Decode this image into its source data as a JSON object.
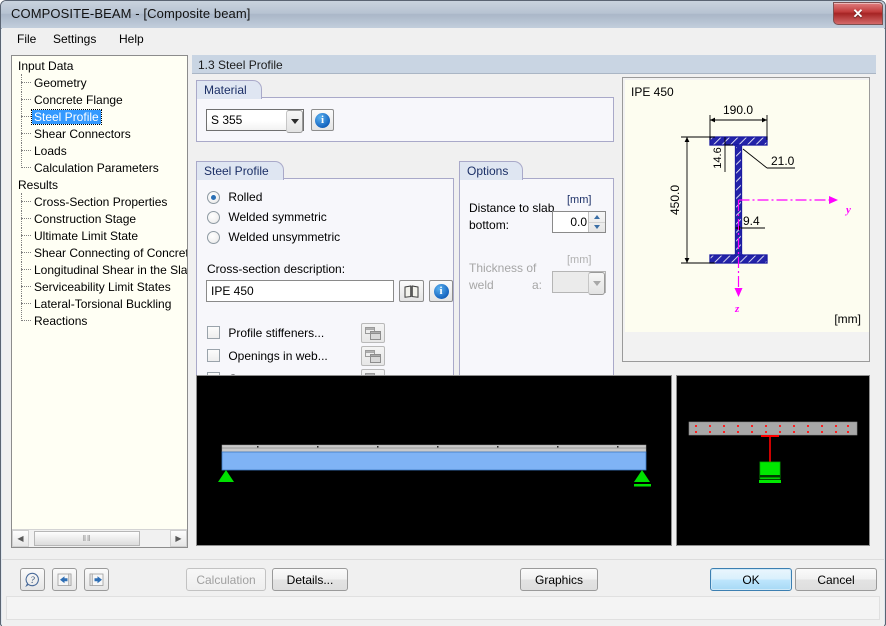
{
  "window": {
    "title": "COMPOSITE-BEAM - [Composite beam]",
    "close_label": "✕"
  },
  "menu": {
    "items": [
      {
        "label": "File"
      },
      {
        "label": "Settings"
      },
      {
        "label": "Help"
      }
    ]
  },
  "sidebar": {
    "groups": [
      {
        "label": "Input Data",
        "items": [
          {
            "label": "Geometry",
            "selected": false
          },
          {
            "label": "Concrete Flange",
            "selected": false
          },
          {
            "label": "Steel Profile",
            "selected": true
          },
          {
            "label": "Shear Connectors",
            "selected": false
          },
          {
            "label": "Loads",
            "selected": false
          },
          {
            "label": "Calculation Parameters",
            "selected": false
          }
        ]
      },
      {
        "label": "Results",
        "items": [
          {
            "label": "Cross-Section Properties",
            "selected": false
          },
          {
            "label": "Construction Stage",
            "selected": false
          },
          {
            "label": "Ultimate Limit State",
            "selected": false
          },
          {
            "label": "Shear Connecting of Concrete I",
            "selected": false
          },
          {
            "label": "Longitudinal Shear in the Slab",
            "selected": false
          },
          {
            "label": "Serviceability Limit States",
            "selected": false
          },
          {
            "label": "Lateral-Torsional Buckling",
            "selected": false
          },
          {
            "label": "Reactions",
            "selected": false
          }
        ]
      }
    ],
    "scroll_thumb_glyph": "‖‖",
    "scroll_left_glyph": "◀",
    "scroll_right_glyph": "▶"
  },
  "page": {
    "title": "1.3 Steel Profile"
  },
  "material": {
    "group_label": "Material",
    "value": "S 355",
    "info_glyph": "i"
  },
  "steel_profile": {
    "group_label": "Steel Profile",
    "options": [
      {
        "label": "Rolled",
        "checked": true
      },
      {
        "label": "Welded symmetric",
        "checked": false
      },
      {
        "label": "Welded unsymmetric",
        "checked": false
      }
    ],
    "description_label": "Cross-section description:",
    "description_value": "IPE 450",
    "library_glyph": "📖",
    "info_glyph": "i",
    "checkboxes": [
      {
        "label": "Profile stiffeners...",
        "checked": false
      },
      {
        "label": "Openings in web...",
        "checked": false
      },
      {
        "label": "Concrete encasement...",
        "checked": false
      }
    ]
  },
  "options": {
    "group_label": "Options",
    "distance_label_line1": "Distance to slab",
    "distance_label_line2": "bottom:",
    "distance_value": "0.0",
    "distance_unit": "[mm]",
    "weld_label_line1": "Thickness of",
    "weld_label_line2": "weld",
    "weld_label_suffix": "a:",
    "weld_value": "",
    "weld_unit": "[mm]"
  },
  "cross_section": {
    "name": "IPE 450",
    "unit": "[mm]",
    "dim_width": "190.0",
    "dim_height": "450.0",
    "dim_flange": "14.6",
    "dim_radius": "21.0",
    "dim_web": "9.4",
    "axis_y": "y",
    "axis_z": "z",
    "colors": {
      "profile": "#1a1aa0",
      "axis": "#ff00ff",
      "background": "#fdfdf0"
    }
  },
  "graphics": {
    "elevation": {
      "beam_color": "#7fb3f5",
      "slab_color": "#c8c8c8",
      "support_color": "#00d000",
      "background": "#000000"
    },
    "section": {
      "slab_color": "#a8a8a8",
      "stud_color": "#ff0000",
      "support_color": "#00e000",
      "background": "#000000"
    }
  },
  "buttonbar": {
    "help_glyph": "?",
    "prev_glyph": "◀",
    "next_glyph": "▶",
    "calculation_label": "Calculation",
    "details_label": "Details...",
    "graphics_label": "Graphics",
    "ok_label": "OK",
    "cancel_label": "Cancel"
  }
}
